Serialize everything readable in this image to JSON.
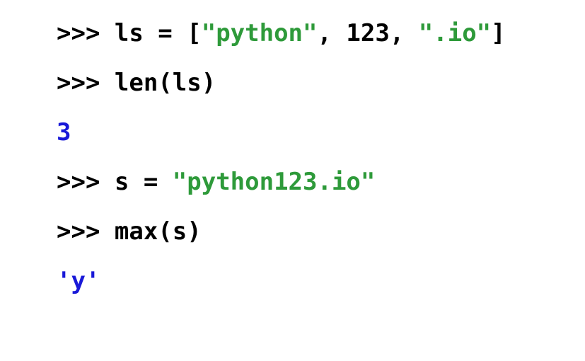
{
  "repl": {
    "prompt": ">>> ",
    "line1": {
      "code1": "ls = [",
      "str1": "\"python\"",
      "code2": ", 123, ",
      "str2": "\".io\"",
      "code3": "]"
    },
    "line2": {
      "code": "len(ls)"
    },
    "output1": "3",
    "line3": {
      "code1": "s = ",
      "str1": "\"python123.io\""
    },
    "line4": {
      "code": "max(s)"
    },
    "output2": "'y'"
  }
}
